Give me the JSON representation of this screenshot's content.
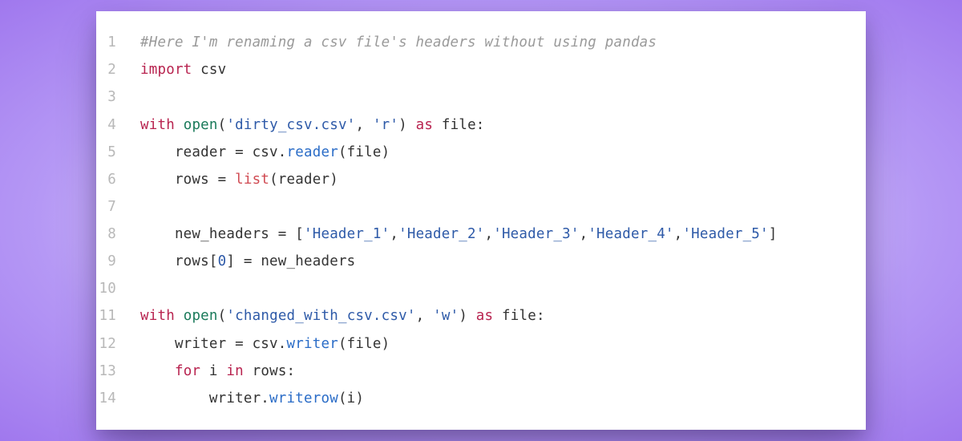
{
  "code": {
    "lines": [
      {
        "num": "1",
        "tokens": [
          {
            "cls": "tok-comment",
            "text": "#Here I'm renaming a csv file's headers without using pandas"
          }
        ]
      },
      {
        "num": "2",
        "tokens": [
          {
            "cls": "tok-keyword",
            "text": "import"
          },
          {
            "cls": "tok-plain",
            "text": " csv"
          }
        ]
      },
      {
        "num": "3",
        "tokens": []
      },
      {
        "num": "4",
        "tokens": [
          {
            "cls": "tok-keyword",
            "text": "with"
          },
          {
            "cls": "tok-plain",
            "text": " "
          },
          {
            "cls": "tok-builtin",
            "text": "open"
          },
          {
            "cls": "tok-punct",
            "text": "("
          },
          {
            "cls": "tok-string",
            "text": "'dirty_csv.csv'"
          },
          {
            "cls": "tok-punct",
            "text": ", "
          },
          {
            "cls": "tok-string",
            "text": "'r'"
          },
          {
            "cls": "tok-punct",
            "text": ") "
          },
          {
            "cls": "tok-keyword",
            "text": "as"
          },
          {
            "cls": "tok-plain",
            "text": " file:"
          }
        ]
      },
      {
        "num": "5",
        "tokens": [
          {
            "cls": "tok-plain",
            "text": "    reader = csv."
          },
          {
            "cls": "tok-func",
            "text": "reader"
          },
          {
            "cls": "tok-plain",
            "text": "(file)"
          }
        ]
      },
      {
        "num": "6",
        "tokens": [
          {
            "cls": "tok-plain",
            "text": "    rows = "
          },
          {
            "cls": "tok-builtin2",
            "text": "list"
          },
          {
            "cls": "tok-plain",
            "text": "(reader)"
          }
        ]
      },
      {
        "num": "7",
        "tokens": []
      },
      {
        "num": "8",
        "tokens": [
          {
            "cls": "tok-plain",
            "text": "    new_headers = ["
          },
          {
            "cls": "tok-string",
            "text": "'Header_1'"
          },
          {
            "cls": "tok-punct",
            "text": ","
          },
          {
            "cls": "tok-string",
            "text": "'Header_2'"
          },
          {
            "cls": "tok-punct",
            "text": ","
          },
          {
            "cls": "tok-string",
            "text": "'Header_3'"
          },
          {
            "cls": "tok-punct",
            "text": ","
          },
          {
            "cls": "tok-string",
            "text": "'Header_4'"
          },
          {
            "cls": "tok-punct",
            "text": ","
          },
          {
            "cls": "tok-string",
            "text": "'Header_5'"
          },
          {
            "cls": "tok-punct",
            "text": "]"
          }
        ]
      },
      {
        "num": "9",
        "tokens": [
          {
            "cls": "tok-plain",
            "text": "    rows["
          },
          {
            "cls": "tok-number",
            "text": "0"
          },
          {
            "cls": "tok-plain",
            "text": "] = new_headers"
          }
        ]
      },
      {
        "num": "10",
        "tokens": []
      },
      {
        "num": "11",
        "tokens": [
          {
            "cls": "tok-keyword",
            "text": "with"
          },
          {
            "cls": "tok-plain",
            "text": " "
          },
          {
            "cls": "tok-builtin",
            "text": "open"
          },
          {
            "cls": "tok-punct",
            "text": "("
          },
          {
            "cls": "tok-string",
            "text": "'changed_with_csv.csv'"
          },
          {
            "cls": "tok-punct",
            "text": ", "
          },
          {
            "cls": "tok-string",
            "text": "'w'"
          },
          {
            "cls": "tok-punct",
            "text": ") "
          },
          {
            "cls": "tok-keyword",
            "text": "as"
          },
          {
            "cls": "tok-plain",
            "text": " file:"
          }
        ]
      },
      {
        "num": "12",
        "tokens": [
          {
            "cls": "tok-plain",
            "text": "    writer = csv."
          },
          {
            "cls": "tok-func",
            "text": "writer"
          },
          {
            "cls": "tok-plain",
            "text": "(file)"
          }
        ]
      },
      {
        "num": "13",
        "tokens": [
          {
            "cls": "tok-plain",
            "text": "    "
          },
          {
            "cls": "tok-keyword",
            "text": "for"
          },
          {
            "cls": "tok-plain",
            "text": " i "
          },
          {
            "cls": "tok-keyword",
            "text": "in"
          },
          {
            "cls": "tok-plain",
            "text": " rows:"
          }
        ]
      },
      {
        "num": "14",
        "tokens": [
          {
            "cls": "tok-plain",
            "text": "        writer."
          },
          {
            "cls": "tok-func",
            "text": "writerow"
          },
          {
            "cls": "tok-plain",
            "text": "(i)"
          }
        ]
      }
    ]
  }
}
